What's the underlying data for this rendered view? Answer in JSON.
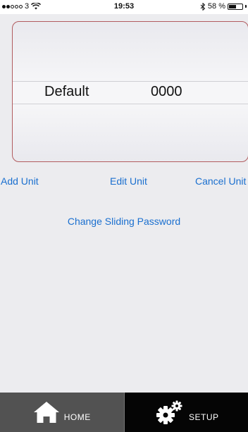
{
  "status_bar": {
    "carrier": "3",
    "time": "19:53",
    "battery_percent": "58 %",
    "battery_level": 0.58
  },
  "picker": {
    "selected_unit": "Default",
    "selected_code": "0000"
  },
  "actions": {
    "add_unit": "Add Unit",
    "edit_unit": "Edit Unit",
    "cancel_unit": "Cancel Unit",
    "change_password": "Change Sliding Password"
  },
  "tabs": [
    {
      "label": "HOME",
      "icon": "home-icon"
    },
    {
      "label": "SETUP",
      "icon": "gears-icon"
    }
  ],
  "colors": {
    "link": "#1a6fcf",
    "picker_border": "#b25c5f",
    "home_tab_bg": "#525252",
    "setup_tab_bg": "#050505",
    "page_bg": "#ececef"
  }
}
